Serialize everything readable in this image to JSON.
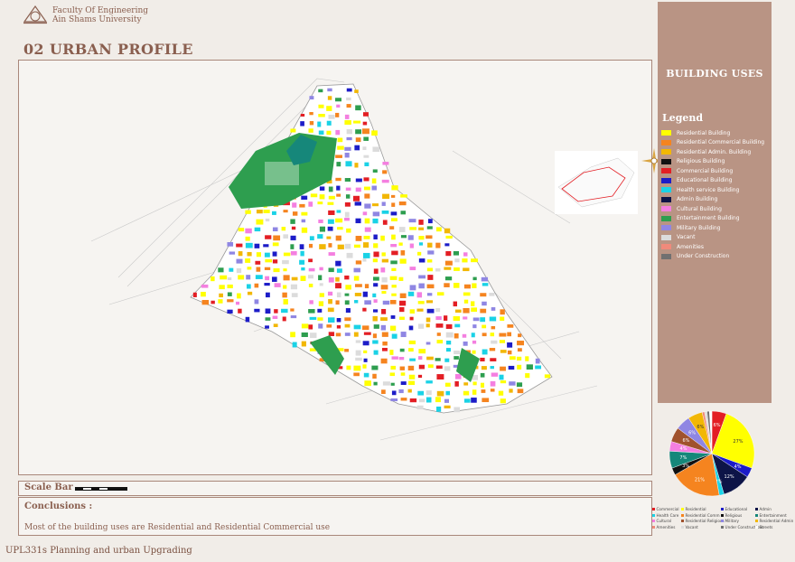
{
  "header": {
    "line1": "Faculty Of Engineering",
    "line2": "Ain Shams University"
  },
  "section": {
    "number": "02",
    "title": "URBAN PROFILE"
  },
  "side_panel": {
    "title": "BUILDING USES",
    "legend_title": "Legend"
  },
  "legend": [
    {
      "label": "Residential Building",
      "color": "#ffff00"
    },
    {
      "label": "Residential Commercial Building",
      "color": "#f5841f"
    },
    {
      "label": "Residential Admin. Building",
      "color": "#f2b705"
    },
    {
      "label": "Religious Building",
      "color": "#111111"
    },
    {
      "label": "Commercial Building",
      "color": "#e31e24"
    },
    {
      "label": "Educational Building",
      "color": "#1c1cc8"
    },
    {
      "label": "Health service Building",
      "color": "#1ad2e6"
    },
    {
      "label": "Admin Building",
      "color": "#0d1447"
    },
    {
      "label": "Cultural Building",
      "color": "#f47fe0"
    },
    {
      "label": "Entertainment Building",
      "color": "#2e9e4f"
    },
    {
      "label": "Military Building",
      "color": "#8f86e3"
    },
    {
      "label": "Vacant",
      "color": "#dcdcdc"
    },
    {
      "label": "Amenities",
      "color": "#f08a7b"
    },
    {
      "label": "Under Construction",
      "color": "#707070"
    }
  ],
  "chart_data": {
    "type": "pie",
    "labels": [
      "27%",
      "4%",
      "12%",
      "2%",
      "21%",
      "3%",
      "7%",
      "4%",
      "6%",
      "6%",
      "6%"
    ],
    "series": [
      {
        "label": "Commercial",
        "value": 6,
        "color": "#e31e24",
        "pct": "6%"
      },
      {
        "label": "Residential",
        "value": 27,
        "color": "#ffff00",
        "pct": "27%"
      },
      {
        "label": "Educational",
        "value": 4,
        "color": "#1c1cc8",
        "pct": "4%"
      },
      {
        "label": "Admin",
        "value": 12,
        "color": "#0d1447",
        "pct": "12%"
      },
      {
        "label": "Health Care",
        "value": 2,
        "color": "#1ad2e6",
        "pct": "2%"
      },
      {
        "label": "Residential Comm",
        "value": 21,
        "color": "#f5841f",
        "pct": "21%"
      },
      {
        "label": "Religious",
        "value": 3,
        "color": "#111111",
        "pct": "3%"
      },
      {
        "label": "Entertainment",
        "value": 7,
        "color": "#16877a",
        "pct": "7%"
      },
      {
        "label": "Cultural",
        "value": 4,
        "color": "#f47fe0",
        "pct": "4%"
      },
      {
        "label": "Residential Religious",
        "value": 6,
        "color": "#a0522d",
        "pct": "6%"
      },
      {
        "label": "Military",
        "value": 6,
        "color": "#8f86e3",
        "pct": "6%"
      },
      {
        "label": "Residential Admin",
        "value": 6,
        "color": "#f2b705",
        "pct": "6%"
      },
      {
        "label": "Amenities",
        "value": 1,
        "color": "#f08a7b",
        "pct": ""
      },
      {
        "label": "Vacant",
        "value": 1,
        "color": "#dcdcdc",
        "pct": ""
      },
      {
        "label": "Under Constructions",
        "value": 1,
        "color": "#707070",
        "pct": ""
      },
      {
        "label": "Streets",
        "value": 1,
        "color": "#ffffff",
        "pct": ""
      }
    ]
  },
  "pie_legend": [
    {
      "label": "Commercial",
      "color": "#e31e24"
    },
    {
      "label": "Residential",
      "color": "#ffff00"
    },
    {
      "label": "Educational",
      "color": "#1c1cc8"
    },
    {
      "label": "Admin",
      "color": "#0d1447"
    },
    {
      "label": "Health Care",
      "color": "#1ad2e6"
    },
    {
      "label": "Residential Comm",
      "color": "#f5841f"
    },
    {
      "label": "Religious",
      "color": "#111111"
    },
    {
      "label": "Entertainment",
      "color": "#16877a"
    },
    {
      "label": "Cultural",
      "color": "#f47fe0"
    },
    {
      "label": "Residential Religious",
      "color": "#a0522d"
    },
    {
      "label": "Military",
      "color": "#8f86e3"
    },
    {
      "label": "Residential Admin",
      "color": "#f2b705"
    },
    {
      "label": "Amenities",
      "color": "#f08a7b"
    },
    {
      "label": "Vacant",
      "color": "#dcdcdc"
    },
    {
      "label": "Under Constructions",
      "color": "#707070"
    },
    {
      "label": "Streets",
      "color": "#ffffff"
    }
  ],
  "scalebar": {
    "label": "Scale Bar"
  },
  "conclusions": {
    "title": "Conclusions :",
    "text": "Most of the building uses are Residential and Residential Commercial use"
  },
  "footer": {
    "course": "UPL331s Planning and urban Upgrading"
  }
}
